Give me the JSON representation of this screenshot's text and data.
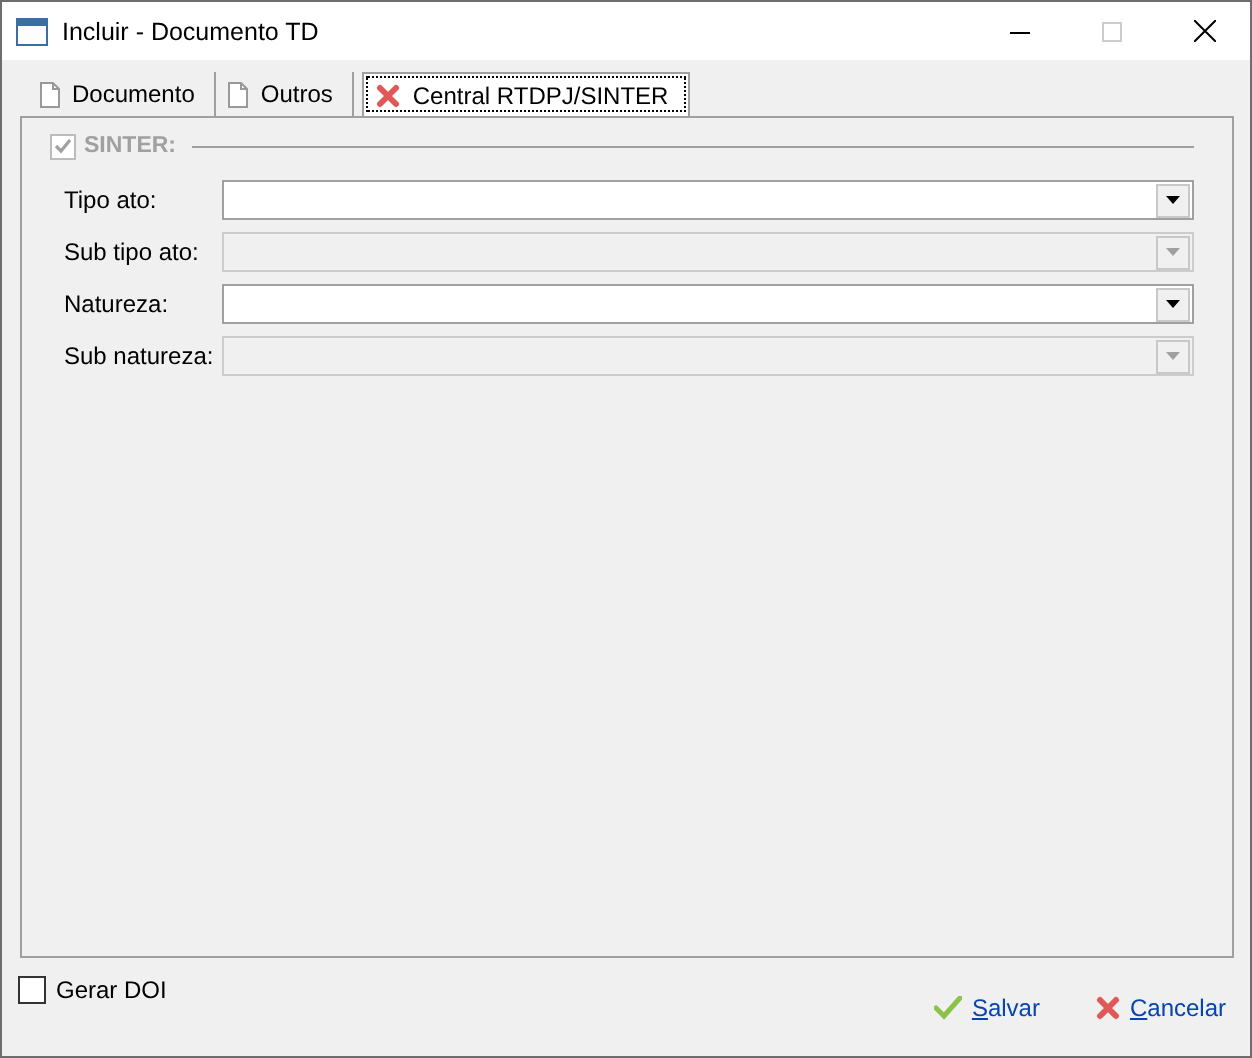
{
  "window": {
    "title": "Incluir - Documento TD",
    "maximize_disabled": true
  },
  "tabs": [
    {
      "label": "Documento",
      "kind": "document",
      "selected": false
    },
    {
      "label": "Outros",
      "kind": "document",
      "selected": false
    },
    {
      "label": "Central RTDPJ/SINTER",
      "kind": "error",
      "selected": true
    }
  ],
  "group": {
    "label": "SINTER:",
    "checked": true,
    "disabled": true
  },
  "fields": [
    {
      "label": "Tipo ato:",
      "disabled": false
    },
    {
      "label": "Sub tipo ato:",
      "disabled": true
    },
    {
      "label": "Natureza:",
      "disabled": false
    },
    {
      "label": "Sub natureza:",
      "disabled": true
    }
  ],
  "footer": {
    "checkbox": {
      "label": "Gerar DOI",
      "checked": false
    },
    "buttons": [
      {
        "label": "Salvar",
        "kind": "ok"
      },
      {
        "label": "Cancelar",
        "kind": "cancel"
      }
    ]
  }
}
